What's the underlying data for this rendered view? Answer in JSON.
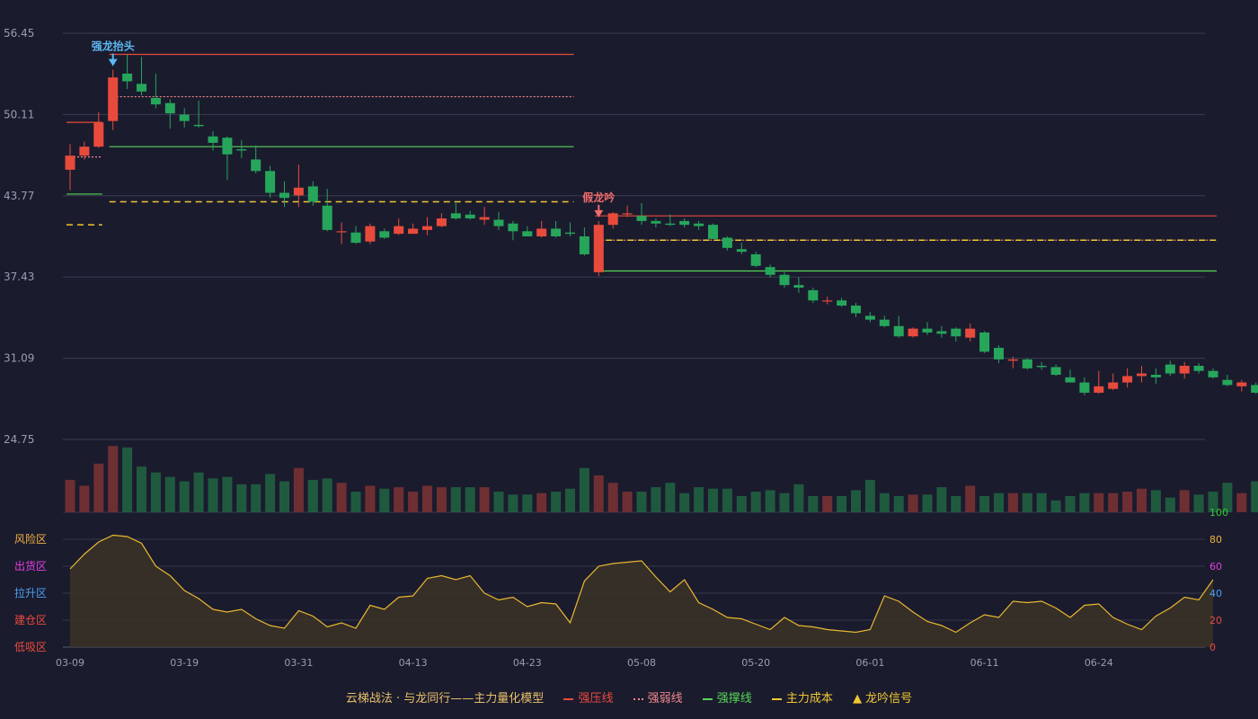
{
  "chart_data": [
    {
      "type": "candlestick",
      "y_ticks": [
        "56.45",
        "50.11",
        "43.77",
        "37.43",
        "31.09",
        "24.75"
      ],
      "ylim": [
        24.75,
        56.45
      ],
      "x_tick_labels": [
        "03-09",
        "03-19",
        "03-31",
        "04-13",
        "04-23",
        "05-08",
        "05-20",
        "06-01",
        "06-11",
        "06-24"
      ],
      "x_tick_indices": [
        0,
        8,
        16,
        24,
        32,
        40,
        48,
        56,
        64,
        72
      ],
      "candles": [
        [
          45.8,
          46.9,
          44.2,
          47.8
        ],
        [
          46.9,
          47.6,
          46.6,
          48.0
        ],
        [
          47.6,
          49.5,
          47.5,
          50.3
        ],
        [
          49.6,
          53.0,
          48.9,
          53.6
        ],
        [
          53.3,
          52.7,
          52.1,
          54.8
        ],
        [
          52.5,
          51.9,
          51.6,
          54.6
        ],
        [
          51.4,
          50.9,
          50.6,
          53.3
        ],
        [
          51.0,
          50.2,
          49.0,
          51.3
        ],
        [
          50.1,
          49.6,
          49.1,
          50.6
        ],
        [
          49.3,
          49.2,
          49.1,
          51.2
        ],
        [
          48.4,
          47.9,
          47.3,
          48.8
        ],
        [
          48.3,
          47.0,
          45.0,
          48.4
        ],
        [
          47.4,
          47.3,
          46.7,
          48.1
        ],
        [
          46.6,
          45.7,
          45.5,
          47.7
        ],
        [
          45.7,
          44.0,
          43.6,
          46.1
        ],
        [
          44.0,
          43.6,
          42.9,
          44.9
        ],
        [
          43.8,
          44.4,
          42.9,
          46.2
        ],
        [
          44.5,
          43.3,
          43.0,
          44.9
        ],
        [
          43.0,
          41.1,
          41.0,
          44.3
        ],
        [
          41.0,
          41.0,
          40.0,
          41.7
        ],
        [
          40.9,
          40.1,
          40.0,
          41.4
        ],
        [
          40.2,
          41.4,
          40.0,
          41.6
        ],
        [
          41.0,
          40.5,
          40.4,
          41.2
        ],
        [
          40.8,
          41.4,
          40.7,
          42.0
        ],
        [
          40.8,
          41.2,
          40.8,
          41.6
        ],
        [
          41.1,
          41.4,
          40.7,
          42.1
        ],
        [
          41.4,
          42.0,
          41.3,
          42.4
        ],
        [
          42.4,
          42.0,
          41.9,
          43.2
        ],
        [
          42.3,
          42.0,
          41.9,
          42.6
        ],
        [
          41.9,
          42.1,
          41.5,
          42.9
        ],
        [
          41.9,
          41.4,
          41.1,
          42.5
        ],
        [
          41.6,
          41.0,
          40.3,
          41.8
        ],
        [
          41.0,
          40.6,
          40.6,
          41.4
        ],
        [
          40.6,
          41.2,
          40.5,
          41.8
        ],
        [
          41.2,
          40.6,
          40.5,
          41.8
        ],
        [
          40.9,
          40.8,
          40.6,
          41.7
        ],
        [
          40.6,
          39.2,
          39.1,
          41.3
        ],
        [
          37.8,
          41.5,
          37.5,
          41.8
        ],
        [
          41.5,
          42.4,
          41.2,
          42.5
        ],
        [
          42.4,
          42.4,
          42.1,
          43.0
        ],
        [
          42.2,
          41.8,
          41.5,
          43.2
        ],
        [
          41.8,
          41.6,
          41.3,
          42.0
        ],
        [
          41.6,
          41.5,
          41.4,
          42.3
        ],
        [
          41.8,
          41.5,
          41.3,
          42.0
        ],
        [
          41.6,
          41.4,
          41.1,
          41.8
        ],
        [
          41.5,
          40.4,
          40.4,
          41.6
        ],
        [
          40.5,
          39.7,
          39.5,
          40.6
        ],
        [
          39.6,
          39.4,
          39.2,
          40.1
        ],
        [
          39.2,
          38.3,
          38.2,
          39.4
        ],
        [
          38.2,
          37.6,
          37.4,
          38.4
        ],
        [
          37.6,
          36.8,
          36.6,
          37.8
        ],
        [
          36.8,
          36.6,
          36.2,
          37.4
        ],
        [
          36.4,
          35.6,
          35.4,
          36.6
        ],
        [
          35.6,
          35.6,
          35.3,
          35.9
        ],
        [
          35.6,
          35.2,
          35.1,
          35.8
        ],
        [
          35.2,
          34.6,
          34.3,
          35.4
        ],
        [
          34.4,
          34.1,
          33.9,
          34.7
        ],
        [
          34.1,
          33.6,
          33.5,
          34.4
        ],
        [
          33.6,
          32.8,
          32.7,
          34.4
        ],
        [
          32.8,
          33.4,
          32.7,
          33.5
        ],
        [
          33.4,
          33.1,
          32.9,
          33.9
        ],
        [
          33.2,
          33.0,
          32.7,
          33.6
        ],
        [
          33.4,
          32.8,
          32.4,
          33.5
        ],
        [
          32.7,
          33.4,
          32.4,
          33.8
        ],
        [
          33.1,
          31.6,
          31.5,
          33.2
        ],
        [
          31.9,
          31.0,
          30.7,
          32.1
        ],
        [
          30.9,
          31.0,
          30.3,
          31.2
        ],
        [
          31.0,
          30.3,
          30.2,
          31.1
        ],
        [
          30.5,
          30.4,
          30.2,
          30.8
        ],
        [
          30.4,
          29.8,
          29.7,
          30.6
        ],
        [
          29.6,
          29.2,
          29.2,
          30.2
        ],
        [
          29.2,
          28.4,
          28.2,
          29.6
        ],
        [
          28.4,
          28.9,
          28.3,
          30.1
        ],
        [
          28.7,
          29.2,
          28.6,
          29.9
        ],
        [
          29.2,
          29.7,
          28.8,
          30.3
        ],
        [
          29.7,
          29.9,
          29.2,
          30.5
        ],
        [
          29.8,
          29.6,
          29.1,
          30.3
        ],
        [
          30.6,
          29.9,
          29.7,
          30.9
        ],
        [
          29.9,
          30.5,
          29.5,
          30.8
        ],
        [
          30.5,
          30.1,
          29.9,
          30.7
        ],
        [
          30.1,
          29.6,
          29.5,
          30.3
        ],
        [
          29.4,
          29.0,
          28.9,
          29.8
        ],
        [
          28.9,
          29.2,
          28.5,
          29.4
        ],
        [
          29.0,
          28.4,
          28.3,
          29.2
        ],
        [
          28.7,
          28.2,
          27.5,
          29.2
        ],
        [
          28.4,
          28.5,
          27.9,
          28.7
        ],
        [
          28.5,
          27.9,
          27.6,
          28.6
        ],
        [
          27.5,
          27.0,
          26.8,
          28.0
        ],
        [
          27.2,
          26.6,
          26.4,
          27.6
        ],
        [
          26.5,
          26.8,
          26.0,
          27.1
        ],
        [
          26.9,
          26.6,
          26.5,
          27.3
        ],
        [
          26.5,
          27.1,
          26.2,
          27.6
        ],
        [
          27.0,
          26.8,
          26.7,
          27.4
        ],
        [
          27.0,
          27.4,
          26.8,
          28.1
        ]
      ],
      "volumes": [
        22,
        18,
        33,
        45,
        44,
        31,
        27,
        24,
        21,
        27,
        23,
        24,
        19,
        19,
        26,
        21,
        30,
        22,
        23,
        20,
        14,
        18,
        16,
        17,
        14,
        18,
        17,
        17,
        17,
        17,
        14,
        12,
        12,
        13,
        14,
        16,
        30,
        25,
        20,
        14,
        14,
        17,
        20,
        13,
        17,
        16,
        16,
        11,
        14,
        15,
        13,
        19,
        11,
        11,
        11,
        15,
        22,
        13,
        11,
        12,
        12,
        17,
        11,
        18,
        11,
        13,
        13,
        13,
        13,
        8,
        11,
        13,
        13,
        13,
        14,
        16,
        15,
        10,
        15,
        12,
        14
      ],
      "volumes_trailing": [
        20,
        13,
        21,
        14,
        15
      ],
      "annotations": [
        {
          "text": "强龙抬头",
          "index": 3
        },
        {
          "text": "假龙吟",
          "index": 37
        }
      ],
      "lines": {
        "strong_pressure": [
          {
            "from": 0,
            "to": 2,
            "y": 49.5
          },
          {
            "from": 3,
            "to": 35,
            "y": 54.8
          },
          {
            "from": 37,
            "to": 80,
            "y": 42.2
          }
        ],
        "weak_line": [
          {
            "from": 0,
            "to": 2,
            "y": 46.8
          },
          {
            "from": 3,
            "to": 35,
            "y": 51.5
          },
          {
            "from": 37,
            "to": 80,
            "y": 40.3
          }
        ],
        "support": [
          {
            "from": 0,
            "to": 2,
            "y": 43.9
          },
          {
            "from": 3,
            "to": 35,
            "y": 47.6
          },
          {
            "from": 37,
            "to": 80,
            "y": 37.9
          }
        ],
        "main_cost": [
          {
            "from": 0,
            "to": 2,
            "y": 41.5
          },
          {
            "from": 3,
            "to": 35,
            "y": 43.3
          },
          {
            "from": 37,
            "to": 80,
            "y": 40.3
          }
        ]
      },
      "colors": {
        "up": "#e84b3c",
        "down": "#26a65b",
        "pressure": "#e84b3c",
        "weak": "#f08a8a",
        "support": "#55d655",
        "cost": "#f0c830"
      }
    },
    {
      "type": "area",
      "zones": [
        "风险区",
        "出货区",
        "拉升区",
        "建仓区",
        "低吸区"
      ],
      "zone_colors": [
        "#f0b040",
        "#e040e0",
        "#4aa0f0",
        "#e84b3c",
        "#e84b3c"
      ],
      "y_ticks": [
        "100",
        "80",
        "60",
        "40",
        "20",
        "0"
      ],
      "y_tick_colors": [
        "#33cc33",
        "#f0b040",
        "#e040e0",
        "#4aa0f0",
        "#e84b3c",
        "#e84b3c"
      ],
      "ylim": [
        0,
        100
      ],
      "values": [
        58,
        69,
        78,
        83,
        82,
        77,
        60,
        53,
        42,
        36,
        28,
        26,
        28,
        21,
        16,
        14,
        27,
        23,
        15,
        18,
        14,
        31,
        28,
        37,
        38,
        51,
        53,
        50,
        53,
        40,
        35,
        37,
        30,
        33,
        32,
        18,
        49,
        60,
        62,
        63,
        64,
        52,
        41,
        50,
        33,
        28,
        22,
        21,
        17,
        13,
        22,
        16,
        15,
        13,
        12,
        11,
        13,
        38,
        34,
        26,
        19,
        16,
        11,
        18,
        24,
        22,
        34,
        33,
        34,
        29,
        22,
        31,
        32,
        22,
        17,
        13,
        23,
        29,
        37,
        35,
        50
      ]
    }
  ],
  "legend": {
    "title": "云梯战法 · 与龙同行——主力量化模型",
    "items": [
      {
        "label": "强压线",
        "color": "#e84b3c"
      },
      {
        "label": "强弱线",
        "color": "#f08a8a"
      },
      {
        "label": "强撑线",
        "color": "#55d655"
      },
      {
        "label": "主力成本",
        "color": "#f0c830"
      },
      {
        "label": "龙吟信号",
        "color": "#f0c830",
        "icon": "triangle-icon"
      }
    ]
  }
}
